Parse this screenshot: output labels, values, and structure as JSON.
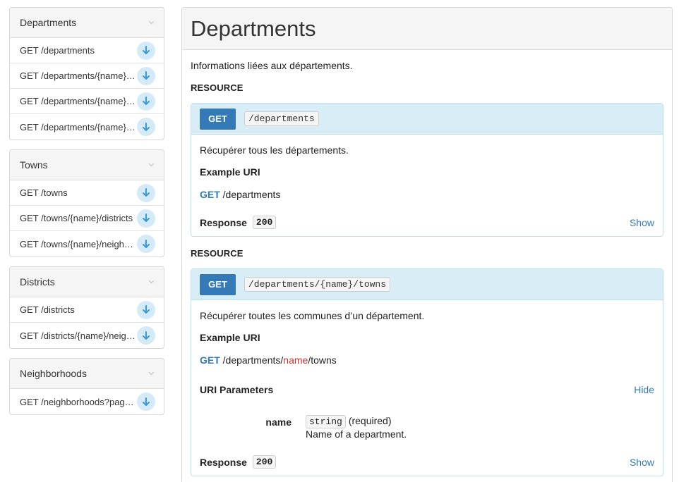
{
  "sidebar": {
    "groups": [
      {
        "title": "Departments",
        "items": [
          {
            "label": "GET /departments"
          },
          {
            "label": "GET /departments/{name}/towns"
          },
          {
            "label": "GET /departments/{name}/districts"
          },
          {
            "label": "GET /departments/{name}/neighborhoods"
          }
        ]
      },
      {
        "title": "Towns",
        "items": [
          {
            "label": "GET /towns"
          },
          {
            "label": "GET /towns/{name}/districts"
          },
          {
            "label": "GET /towns/{name}/neighborhoods"
          }
        ]
      },
      {
        "title": "Districts",
        "items": [
          {
            "label": "GET /districts"
          },
          {
            "label": "GET /districts/{name}/neighborhoods"
          }
        ]
      },
      {
        "title": "Neighborhoods",
        "items": [
          {
            "label": "GET /neighborhoods?page={page}"
          }
        ]
      }
    ],
    "icons": {
      "collapse": "chevron-down-icon",
      "download": "arrow-down-icon"
    }
  },
  "main": {
    "title": "Departments",
    "description": "Informations liées aux départements.",
    "resources": [
      {
        "section_label": "RESOURCE",
        "method": "GET",
        "path": "/departments",
        "description": "Récupérer tous les départements.",
        "example_label": "Example URI",
        "example_method": "GET",
        "example_parts": [
          "/departments"
        ],
        "response_label": "Response",
        "response_code": "200",
        "response_toggle": "Show"
      },
      {
        "section_label": "RESOURCE",
        "method": "GET",
        "path": "/departments/{name}/towns",
        "description": "Récupérer toutes les communes d’un département.",
        "example_label": "Example URI",
        "example_method": "GET",
        "example_parts": [
          "/departments/",
          "name",
          "/towns"
        ],
        "params_label": "URI Parameters",
        "params_toggle": "Hide",
        "params": [
          {
            "name": "name",
            "type": "string",
            "required": "(required)",
            "description": "Name of a department."
          }
        ],
        "response_label": "Response",
        "response_code": "200",
        "response_toggle": "Show"
      }
    ]
  },
  "colors": {
    "accent": "#337ab7",
    "card_header": "#d9edf7",
    "param_highlight": "#c9302c"
  }
}
